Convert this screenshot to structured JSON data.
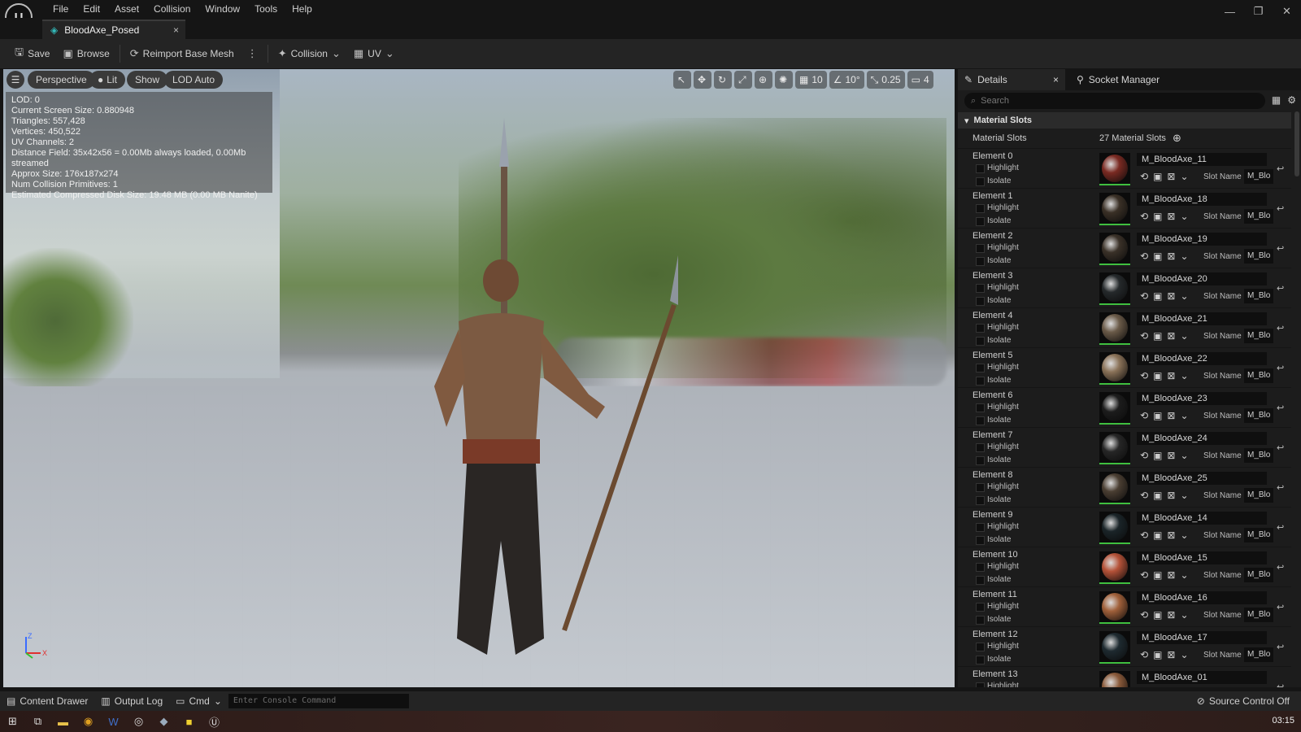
{
  "app": {
    "logo": "U",
    "menu": [
      "File",
      "Edit",
      "Asset",
      "Collision",
      "Window",
      "Tools",
      "Help"
    ],
    "tab_title": "BloodAxe_Posed",
    "tab_close": "×",
    "window_controls": [
      "—",
      "❐",
      "✕"
    ]
  },
  "toolbar": {
    "save": "Save",
    "browse": "Browse",
    "reimport": "Reimport Base Mesh",
    "collision": "Collision",
    "uv": "UV"
  },
  "viewport": {
    "perspective": "Perspective",
    "lit": "Lit",
    "show": "Show",
    "lod": "LOD Auto",
    "grid_snap": "10",
    "rotation_snap": "10°",
    "scale_snap": "0.25",
    "camera_speed": "4",
    "stats": [
      "LOD:  0",
      "Current Screen Size:  0.880948",
      "Triangles:  557,428",
      "Vertices:  450,522",
      "UV Channels:  2",
      "Distance Field:  35x42x56 = 0.00Mb always loaded, 0.00Mb streamed",
      "Approx Size:  176x187x274",
      "Num Collision Primitives:  1",
      "Estimated Compressed Disk Size: 19.48 MB (0.00 MB Nanite)"
    ],
    "axis_z": "Z",
    "axis_x": "X"
  },
  "details": {
    "tab_details": "Details",
    "tab_close": "×",
    "tab_socket": "Socket Manager",
    "search_placeholder": "Search",
    "section_title": "Material Slots",
    "slots_label": "Material Slots",
    "slots_count": "27 Material Slots",
    "highlight_label": "Highlight",
    "isolate_label": "Isolate",
    "slot_name_label": "Slot Name",
    "slot_value_prefix": "M_Blo",
    "elements": [
      {
        "name": "Element 0",
        "material": "M_BloodAxe_11",
        "color": "#7a2a22"
      },
      {
        "name": "Element 1",
        "material": "M_BloodAxe_18",
        "color": "#3a3026"
      },
      {
        "name": "Element 2",
        "material": "M_BloodAxe_19",
        "color": "#3a3128"
      },
      {
        "name": "Element 3",
        "material": "M_BloodAxe_20",
        "color": "#25292b"
      },
      {
        "name": "Element 4",
        "material": "M_BloodAxe_21",
        "color": "#6a5a48"
      },
      {
        "name": "Element 5",
        "material": "M_BloodAxe_22",
        "color": "#8a7258"
      },
      {
        "name": "Element 6",
        "material": "M_BloodAxe_23",
        "color": "#1c1c1c"
      },
      {
        "name": "Element 7",
        "material": "M_BloodAxe_24",
        "color": "#262626"
      },
      {
        "name": "Element 8",
        "material": "M_BloodAxe_25",
        "color": "#4a3e32"
      },
      {
        "name": "Element 9",
        "material": "M_BloodAxe_14",
        "color": "#1a2428"
      },
      {
        "name": "Element 10",
        "material": "M_BloodAxe_15",
        "color": "#b55238"
      },
      {
        "name": "Element 11",
        "material": "M_BloodAxe_16",
        "color": "#a0603a"
      },
      {
        "name": "Element 12",
        "material": "M_BloodAxe_17",
        "color": "#1e2a30"
      },
      {
        "name": "Element 13",
        "material": "M_BloodAxe_01",
        "color": "#8a5a3a"
      }
    ]
  },
  "statusbar": {
    "content_drawer": "Content Drawer",
    "output_log": "Output Log",
    "cmd": "Cmd",
    "console_placeholder": "Enter Console Command",
    "source_control": "Source Control Off"
  },
  "taskbar": {
    "icons": [
      "windows-start",
      "task-view",
      "file-explorer",
      "chrome",
      "word",
      "steam",
      "app",
      "notes",
      "unreal"
    ],
    "clock": "03:15"
  }
}
